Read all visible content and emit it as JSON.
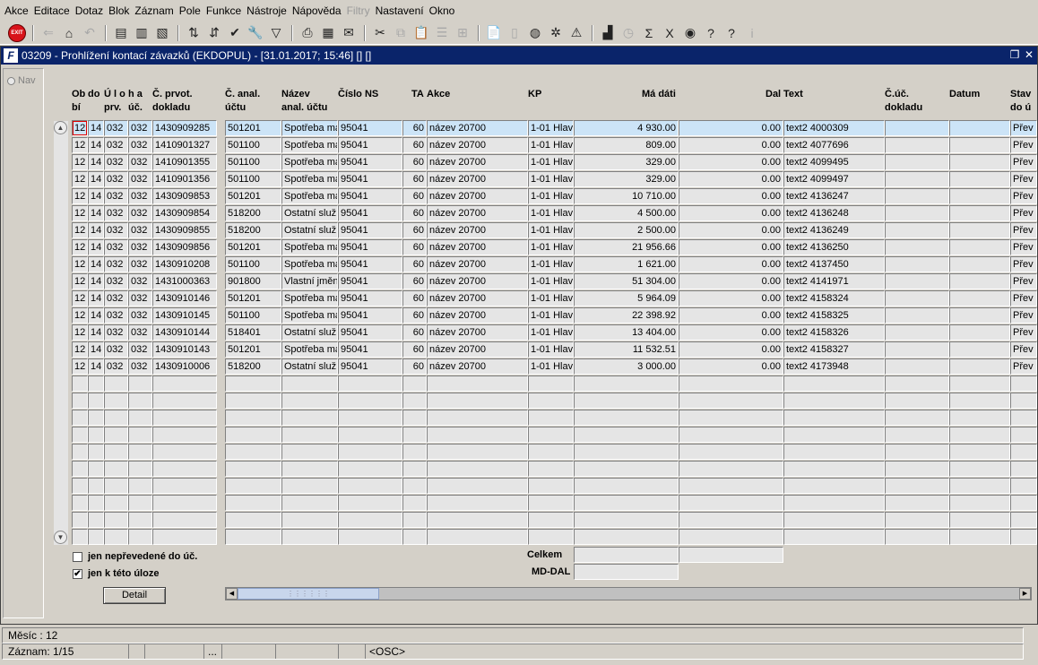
{
  "menu": [
    "Akce",
    "Editace",
    "Dotaz",
    "Blok",
    "Záznam",
    "Pole",
    "Funkce",
    "Nástroje",
    "Nápověda",
    "Filtry",
    "Nastavení",
    "Okno"
  ],
  "menu_disabled": [
    "Filtry"
  ],
  "toolbar": {
    "exit_label": "EXIT",
    "icons": [
      {
        "name": "exit-icon",
        "glyph": "EXIT"
      },
      {
        "sep": true
      },
      {
        "name": "save-icon",
        "glyph": "⇐",
        "dis": true
      },
      {
        "name": "commit-icon",
        "glyph": "⌂"
      },
      {
        "name": "rollback-icon",
        "glyph": "↶",
        "dis": true
      },
      {
        "sep": true
      },
      {
        "name": "insert-record-icon",
        "glyph": "▤"
      },
      {
        "name": "copy-record-icon",
        "glyph": "▥"
      },
      {
        "name": "delete-record-icon",
        "glyph": "▧"
      },
      {
        "sep": true
      },
      {
        "name": "sort-ascending-icon",
        "glyph": "⇅"
      },
      {
        "name": "sort-descending-icon",
        "glyph": "⇵"
      },
      {
        "name": "check-icon",
        "glyph": "✔"
      },
      {
        "name": "tools-icon",
        "glyph": "🔧"
      },
      {
        "name": "filter-icon",
        "glyph": "▽"
      },
      {
        "sep": true
      },
      {
        "name": "print-icon",
        "glyph": "⎙"
      },
      {
        "name": "print-preview-icon",
        "glyph": "▦"
      },
      {
        "name": "mail-icon",
        "glyph": "✉"
      },
      {
        "sep": true
      },
      {
        "name": "cut-icon",
        "glyph": "✂"
      },
      {
        "name": "copy-icon",
        "glyph": "⧉",
        "dis": true
      },
      {
        "name": "paste-icon",
        "glyph": "📋"
      },
      {
        "name": "list-icon",
        "glyph": "☰",
        "dis": true
      },
      {
        "name": "tree-icon",
        "glyph": "⊞",
        "dis": true
      },
      {
        "sep": true
      },
      {
        "name": "clipboard-icon",
        "glyph": "📄"
      },
      {
        "name": "document-icon",
        "glyph": "▯",
        "dis": true
      },
      {
        "name": "globe-icon",
        "glyph": "◍"
      },
      {
        "name": "settings-wheel-icon",
        "glyph": "✲"
      },
      {
        "name": "warning-icon",
        "glyph": "⚠"
      },
      {
        "sep": true
      },
      {
        "name": "chart-icon",
        "glyph": "▟"
      },
      {
        "name": "clock-icon",
        "glyph": "◷",
        "dis": true
      },
      {
        "name": "sum-icon",
        "glyph": "Σ"
      },
      {
        "name": "excel-icon",
        "glyph": "X"
      },
      {
        "name": "web-icon",
        "glyph": "◉"
      },
      {
        "name": "help-context-icon",
        "glyph": "?"
      },
      {
        "name": "help-icon",
        "glyph": "?"
      },
      {
        "name": "info-icon",
        "glyph": "i",
        "dis": true
      }
    ]
  },
  "window": {
    "title": "03209 - Prohlížení kontací závazků (EKDOPUL) - [31.01.2017; 15:46]  [] []",
    "app_icon": "F"
  },
  "nav": {
    "label": "Nav"
  },
  "columns": [
    {
      "key": "obdobi",
      "line1": "Ob",
      "line2": "bí"
    },
    {
      "key": "do",
      "line1": "do",
      "line2": ""
    },
    {
      "key": "ulo_prv",
      "line1": "Ú l o",
      "line2": "prv."
    },
    {
      "key": "ha_uc",
      "line1": "h a",
      "line2": "úč."
    },
    {
      "key": "c_prvot",
      "line1": "Č. prvot.",
      "line2": "dokladu"
    },
    {
      "key": "c_anal",
      "line1": "Č. anal.",
      "line2": "účtu"
    },
    {
      "key": "nazev_anal",
      "line1": "Název",
      "line2": "anal. účtu"
    },
    {
      "key": "cislo_ns",
      "line1": "Číslo NS",
      "line2": ""
    },
    {
      "key": "ta",
      "line1": "TA",
      "line2": ""
    },
    {
      "key": "akce",
      "line1": "Akce",
      "line2": ""
    },
    {
      "key": "kp",
      "line1": "KP",
      "line2": ""
    },
    {
      "key": "ma_dati",
      "line1": "Má dáti",
      "line2": ""
    },
    {
      "key": "dal",
      "line1": "Dal",
      "line2": ""
    },
    {
      "key": "text",
      "line1": "Text",
      "line2": ""
    },
    {
      "key": "c_uc_dokladu",
      "line1": "Č.úč.",
      "line2": "dokladu"
    },
    {
      "key": "datum",
      "line1": "Datum",
      "line2": ""
    },
    {
      "key": "stav",
      "line1": "Stav",
      "line2": "do ú"
    }
  ],
  "rows": [
    [
      "12",
      "14",
      "032",
      "032",
      "1430909285",
      "501201",
      "Spotřeba ma",
      "95041",
      "60",
      "název 20700",
      "1-01 Hlav",
      "4 930.00",
      "0.00",
      "text2 4000309",
      "",
      "",
      "Přev"
    ],
    [
      "12",
      "14",
      "032",
      "032",
      "1410901327",
      "501100",
      "Spotřeba ma",
      "95041",
      "60",
      "název 20700",
      "1-01 Hlav",
      "809.00",
      "0.00",
      "text2 4077696",
      "",
      "",
      "Přev"
    ],
    [
      "12",
      "14",
      "032",
      "032",
      "1410901355",
      "501100",
      "Spotřeba ma",
      "95041",
      "60",
      "název 20700",
      "1-01 Hlav",
      "329.00",
      "0.00",
      "text2 4099495",
      "",
      "",
      "Přev"
    ],
    [
      "12",
      "14",
      "032",
      "032",
      "1410901356",
      "501100",
      "Spotřeba ma",
      "95041",
      "60",
      "název 20700",
      "1-01 Hlav",
      "329.00",
      "0.00",
      "text2 4099497",
      "",
      "",
      "Přev"
    ],
    [
      "12",
      "14",
      "032",
      "032",
      "1430909853",
      "501201",
      "Spotřeba ma",
      "95041",
      "60",
      "název 20700",
      "1-01 Hlav",
      "10 710.00",
      "0.00",
      "text2 4136247",
      "",
      "",
      "Přev"
    ],
    [
      "12",
      "14",
      "032",
      "032",
      "1430909854",
      "518200",
      "Ostatní služ",
      "95041",
      "60",
      "název 20700",
      "1-01 Hlav",
      "4 500.00",
      "0.00",
      "text2 4136248",
      "",
      "",
      "Přev"
    ],
    [
      "12",
      "14",
      "032",
      "032",
      "1430909855",
      "518200",
      "Ostatní služ",
      "95041",
      "60",
      "název 20700",
      "1-01 Hlav",
      "2 500.00",
      "0.00",
      "text2 4136249",
      "",
      "",
      "Přev"
    ],
    [
      "12",
      "14",
      "032",
      "032",
      "1430909856",
      "501201",
      "Spotřeba ma",
      "95041",
      "60",
      "název 20700",
      "1-01 Hlav",
      "21 956.66",
      "0.00",
      "text2 4136250",
      "",
      "",
      "Přev"
    ],
    [
      "12",
      "14",
      "032",
      "032",
      "1430910208",
      "501100",
      "Spotřeba ma",
      "95041",
      "60",
      "název 20700",
      "1-01 Hlav",
      "1 621.00",
      "0.00",
      "text2 4137450",
      "",
      "",
      "Přev"
    ],
    [
      "12",
      "14",
      "032",
      "032",
      "1431000363",
      "901800",
      "Vlastní jměn",
      "95041",
      "60",
      "název 20700",
      "1-01 Hlav",
      "51 304.00",
      "0.00",
      "text2 4141971",
      "",
      "",
      "Přev"
    ],
    [
      "12",
      "14",
      "032",
      "032",
      "1430910146",
      "501201",
      "Spotřeba ma",
      "95041",
      "60",
      "název 20700",
      "1-01 Hlav",
      "5 964.09",
      "0.00",
      "text2 4158324",
      "",
      "",
      "Přev"
    ],
    [
      "12",
      "14",
      "032",
      "032",
      "1430910145",
      "501100",
      "Spotřeba ma",
      "95041",
      "60",
      "název 20700",
      "1-01 Hlav",
      "22 398.92",
      "0.00",
      "text2 4158325",
      "",
      "",
      "Přev"
    ],
    [
      "12",
      "14",
      "032",
      "032",
      "1430910144",
      "518401",
      "Ostatní služ",
      "95041",
      "60",
      "název 20700",
      "1-01 Hlav",
      "13 404.00",
      "0.00",
      "text2 4158326",
      "",
      "",
      "Přev"
    ],
    [
      "12",
      "14",
      "032",
      "032",
      "1430910143",
      "501201",
      "Spotřeba ma",
      "95041",
      "60",
      "název 20700",
      "1-01 Hlav",
      "11 532.51",
      "0.00",
      "text2 4158327",
      "",
      "",
      "Přev"
    ],
    [
      "12",
      "14",
      "032",
      "032",
      "1430910006",
      "518200",
      "Ostatní služ",
      "95041",
      "60",
      "název 20700",
      "1-01 Hlav",
      "3 000.00",
      "0.00",
      "text2 4173948",
      "",
      "",
      "Přev"
    ]
  ],
  "empty_rows": 10,
  "filters": {
    "unposted_label": "jen nepřevedené do úč.",
    "unposted_checked": false,
    "this_task_label": "jen k této úloze",
    "this_task_checked": true
  },
  "detail_button": "Detail",
  "totals": {
    "celkem_label": "Celkem",
    "md_dal_label": "MD-DAL",
    "celkem_ma_dati": "",
    "celkem_dal": "",
    "md_dal": ""
  },
  "status": {
    "line1": "Měsíc : 12",
    "record": "Záznam: 1/15",
    "seg3": "...",
    "osc": "<OSC>"
  },
  "colors": {
    "title_bar": "#0a246a",
    "selected_row": "#cce4f7",
    "field_bg": "#e5e5e5",
    "exit_red": "#d8131a"
  }
}
